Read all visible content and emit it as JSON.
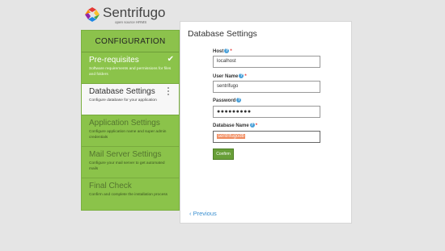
{
  "brand": {
    "name": "Sentrifugo",
    "tagline": "open source HRMS"
  },
  "sidebar": {
    "header": "CONFIGURATION",
    "steps": [
      {
        "title": "Pre-requisites",
        "description": "Software requirements and permissions for files and folders",
        "state": "done"
      },
      {
        "title": "Database Settings",
        "description": "Configure database for your application",
        "state": "active"
      },
      {
        "title": "Application Settings",
        "description": "Configure application name and super admin credentials",
        "state": "pending"
      },
      {
        "title": "Mail Server Settings",
        "description": "Configure your mail server to get automated mails",
        "state": "pending"
      },
      {
        "title": "Final Check",
        "description": "Confirm and complete the installation process",
        "state": "pending"
      }
    ]
  },
  "main": {
    "title": "Database Settings",
    "fields": {
      "host": {
        "label": "Host",
        "value": "localhost"
      },
      "user_name": {
        "label": "User Name",
        "value": "sentrifugo"
      },
      "password": {
        "label": "Password",
        "value": "●●●●●●●●●"
      },
      "database_name": {
        "label": "Database Name",
        "value": "sentrifugodb"
      }
    },
    "required_mark": "*",
    "help_mark": "?",
    "confirm_label": "Confirm",
    "previous_label": "‹ Previous"
  },
  "colors": {
    "sidebar": "#8bc34a",
    "active_step": "#f7f7f7",
    "button": "#689f38",
    "link": "#3a8fd0",
    "required": "#e53935",
    "selection": "#f08a5d"
  }
}
